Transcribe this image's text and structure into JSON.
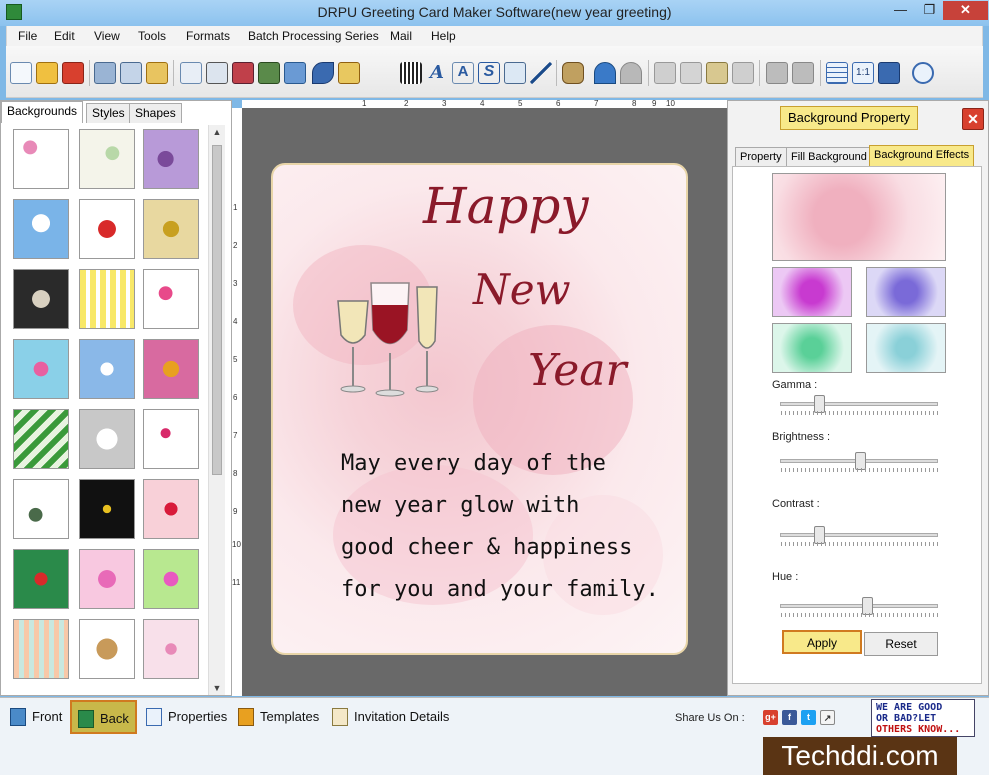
{
  "window": {
    "title": "DRPU Greeting Card Maker Software(new year greeting)",
    "minimize": "—",
    "restore": "❐",
    "close": "✕"
  },
  "menu": [
    "File",
    "Edit",
    "View",
    "Tools",
    "Formats",
    "Batch Processing Series",
    "Mail",
    "Help"
  ],
  "left_tabs": [
    "Backgrounds",
    "Styles",
    "Shapes"
  ],
  "ruler_h": [
    "1",
    "2",
    "3",
    "4",
    "5",
    "6",
    "7",
    "8",
    "9",
    "10"
  ],
  "ruler_v": [
    "1",
    "2",
    "3",
    "4",
    "5",
    "6",
    "7",
    "8",
    "9",
    "10",
    "11"
  ],
  "card": {
    "line1": "Happy",
    "line2": "New",
    "line3": "Year",
    "message": "May every day of the\nnew year glow with\ngood cheer & happiness\nfor you and your family."
  },
  "right_panel": {
    "header": "Background Property",
    "close": "✕",
    "tabs": [
      "Property",
      "Fill Background",
      "Background Effects"
    ],
    "sliders": [
      {
        "label": "Gamma :",
        "value": 0.23
      },
      {
        "label": "Brightness :",
        "value": 0.51
      },
      {
        "label": "Contrast :",
        "value": 0.23
      },
      {
        "label": "Hue :",
        "value": 0.56
      }
    ],
    "apply": "Apply",
    "reset": "Reset"
  },
  "bottom": {
    "front": "Front",
    "back": "Back",
    "properties": "Properties",
    "templates": "Templates",
    "invitation": "Invitation Details",
    "share": "Share Us On :",
    "goodbad": [
      "WE ARE GOOD",
      "OR BAD?LET",
      "OTHERS KNOW..."
    ],
    "watermark": "Techddi.com"
  },
  "colors": {
    "accent": "#f8e98a",
    "title_text": "#8a1a2a",
    "selected_border": "#d07a20"
  }
}
